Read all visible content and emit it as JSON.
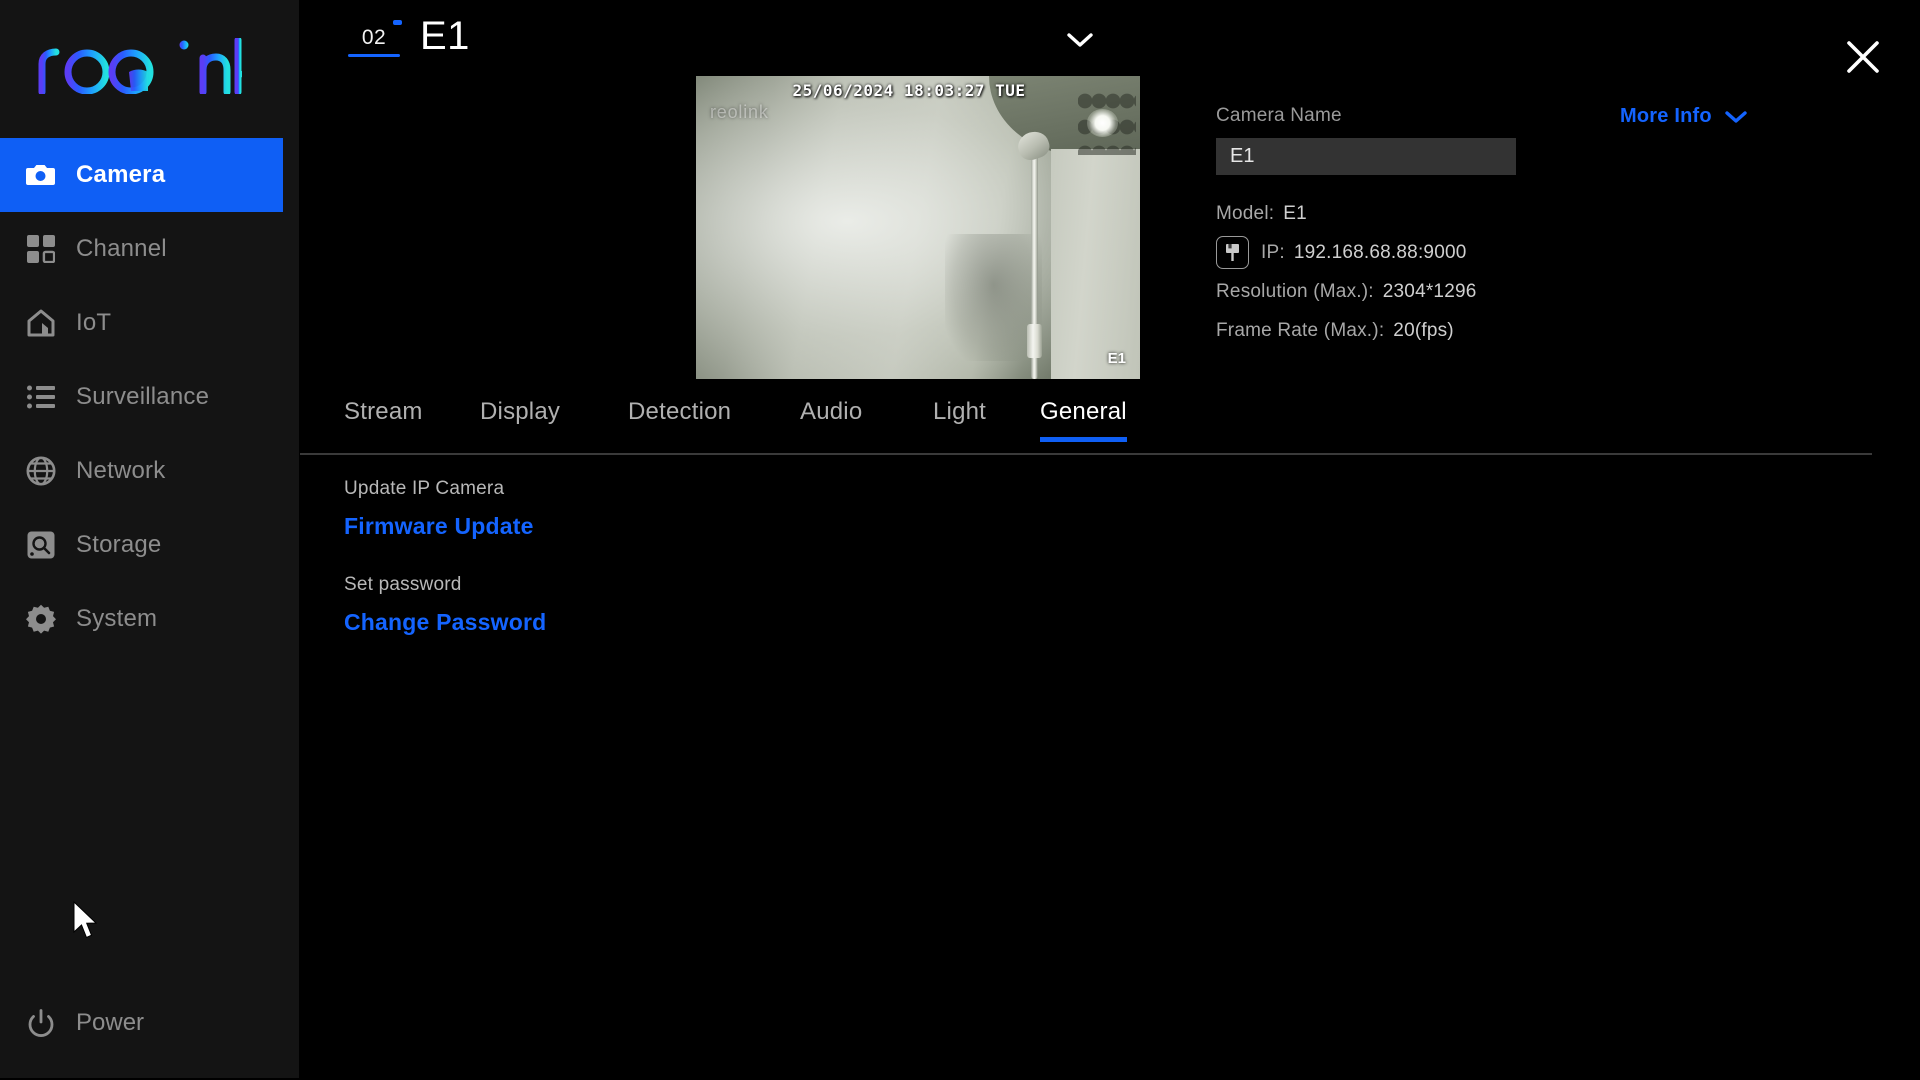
{
  "brand": {
    "logo_text": "reolink"
  },
  "sidebar": {
    "items": [
      {
        "label": "Camera",
        "icon": "camera-icon",
        "active": true
      },
      {
        "label": "Channel",
        "icon": "grid-icon",
        "active": false
      },
      {
        "label": "IoT",
        "icon": "home-icon",
        "active": false
      },
      {
        "label": "Surveillance",
        "icon": "list-icon",
        "active": false
      },
      {
        "label": "Network",
        "icon": "globe-icon",
        "active": false
      },
      {
        "label": "Storage",
        "icon": "disk-search-icon",
        "active": false
      },
      {
        "label": "System",
        "icon": "gear-icon",
        "active": false
      }
    ],
    "power": {
      "label": "Power",
      "icon": "power-icon"
    }
  },
  "header": {
    "channel_number": "02",
    "camera_title": "E1",
    "dropdown_icon": "chevron-down-icon",
    "close_icon": "close-icon"
  },
  "preview": {
    "osd_timestamp": "25/06/2024  18:03:27  TUE",
    "watermark": "reolink",
    "channel_name": "E1"
  },
  "info": {
    "camera_name_label": "Camera Name",
    "camera_name_value": "E1",
    "camera_name_placeholder": "Camera Name",
    "more_info_label": "More Info",
    "more_info_icon": "chevron-down-icon",
    "connection_icon": "poe-ethernet-icon",
    "rows": [
      {
        "key": "Model:",
        "value": "E1"
      },
      {
        "key": "IP:",
        "value": "192.168.68.88:9000"
      },
      {
        "key": "Resolution (Max.):",
        "value": "2304*1296"
      },
      {
        "key": "Frame Rate (Max.):",
        "value": "20(fps)"
      }
    ]
  },
  "tabs": [
    {
      "label": "Stream",
      "active": false
    },
    {
      "label": "Display",
      "active": false
    },
    {
      "label": "Detection",
      "active": false
    },
    {
      "label": "Audio",
      "active": false
    },
    {
      "label": "Light",
      "active": false
    },
    {
      "label": "General",
      "active": true
    }
  ],
  "content": {
    "sections": [
      {
        "label": "Update IP Camera",
        "link": "Firmware Update"
      },
      {
        "label": "Set password",
        "link": "Change Password"
      }
    ]
  },
  "colors": {
    "accent_blue": "#0f5ff5",
    "link_blue": "#1464ff",
    "sidebar_bg": "#141414",
    "page_bg": "#000000",
    "input_bg": "#333333",
    "muted_text": "#8d8d8d"
  }
}
